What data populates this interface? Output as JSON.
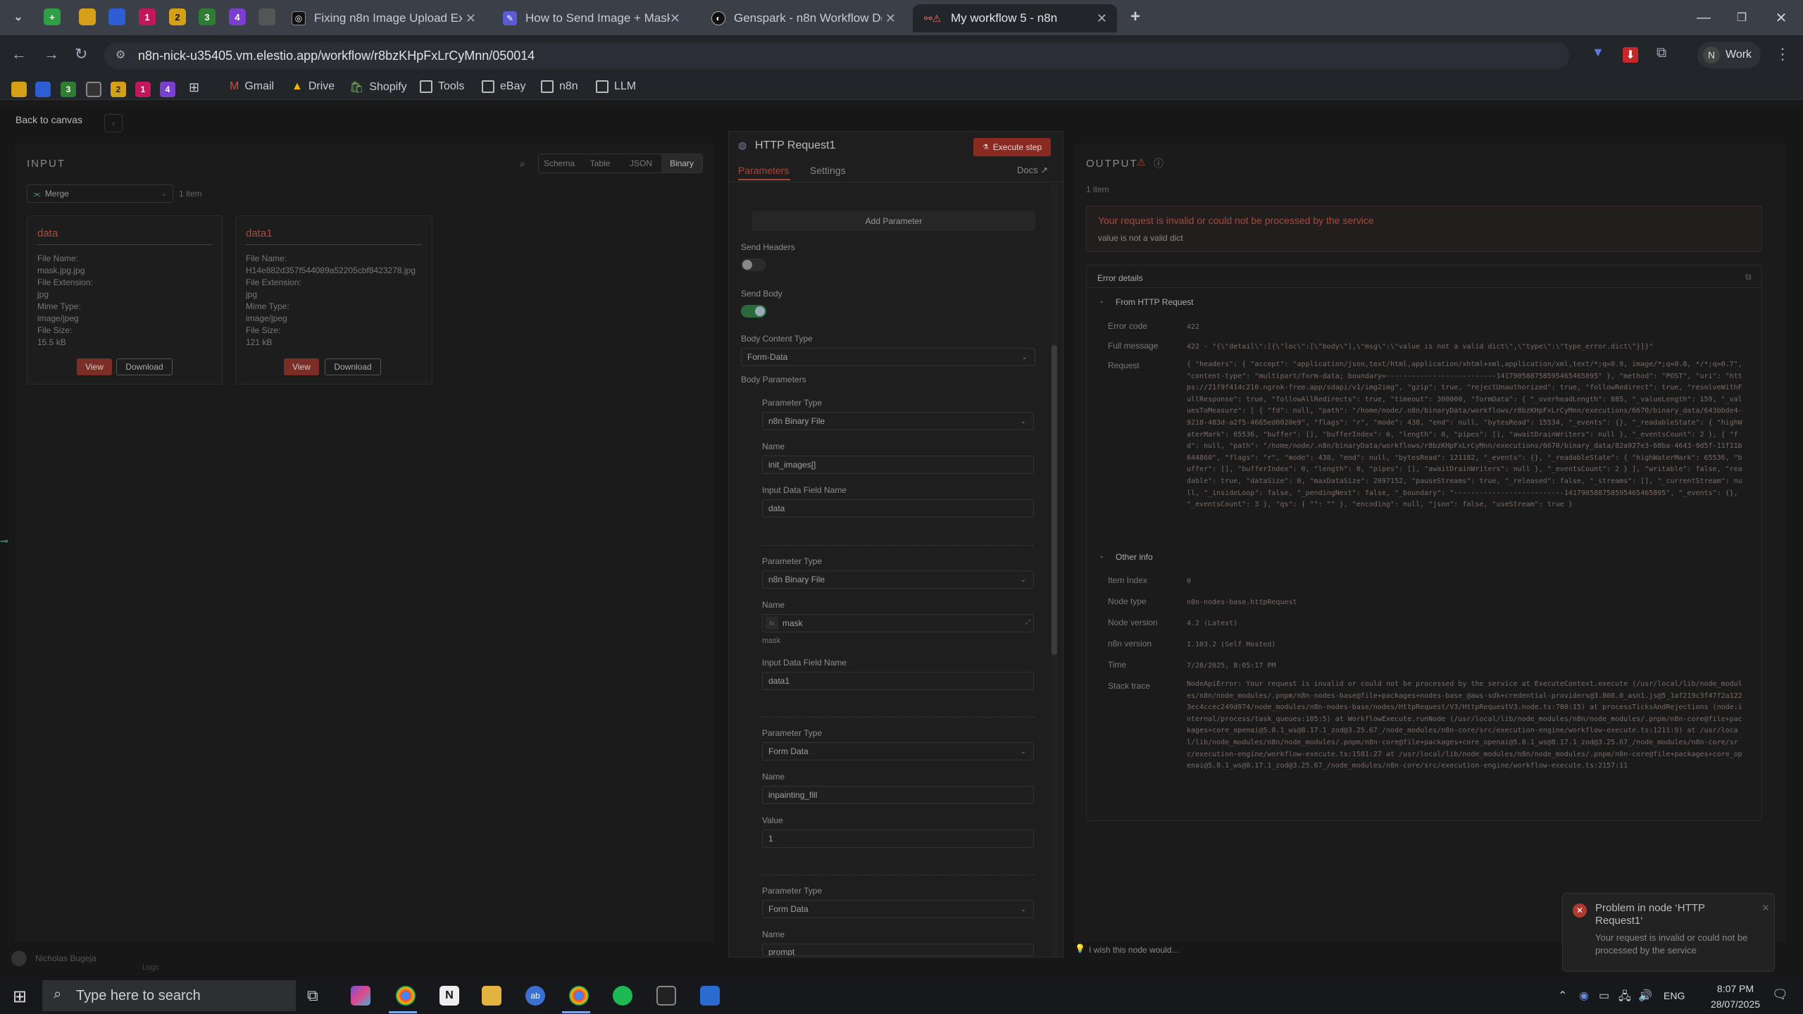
{
  "browser": {
    "tabs": [
      {
        "label": "Fixing n8n Image Upload Expre",
        "icon": "openai-icon"
      },
      {
        "label": "How to Send Image + Mask for",
        "icon": "claude-icon"
      },
      {
        "label": "Genspark - n8n Workflow Desi",
        "icon": "genspark-icon"
      },
      {
        "label": "My workflow 5 - n8n",
        "icon": "n8n-warning-icon"
      }
    ],
    "pinned_tabs": [
      "1",
      "2",
      "3",
      "4"
    ],
    "url": "n8n-nick-u35405.vm.elestio.app/workflow/r8bzKHpFxLrCyMnn/050014",
    "profile": {
      "initial": "N",
      "label": "Work"
    },
    "bookmark_pins": [
      "3",
      "2",
      "1",
      "4"
    ],
    "bookmarks": [
      "Gmail",
      "Drive",
      "Shopify",
      "Tools",
      "eBay",
      "n8n",
      "LLM"
    ]
  },
  "app": {
    "back_label": "Back to canvas",
    "input": {
      "title": "INPUT",
      "views": [
        "Schema",
        "Table",
        "JSON",
        "Binary"
      ],
      "active_view": "Binary",
      "source_node": "Merge",
      "item_count": "1 item",
      "cards": [
        {
          "title": "data",
          "lines": [
            "File Name:",
            "mask.jpg.jpg",
            "File Extension:",
            "jpg",
            "Mime Type:",
            "image/jpeg",
            "File Size:",
            "15.5 kB"
          ],
          "view": "View",
          "download": "Download"
        },
        {
          "title": "data1",
          "lines": [
            "File Name:",
            "H14e882d357f544089a52205cbf8423278.jpg",
            "File Extension:",
            "jpg",
            "Mime Type:",
            "image/jpeg",
            "File Size:",
            "121 kB"
          ],
          "view": "View",
          "download": "Download"
        }
      ]
    },
    "node": {
      "title": "HTTP Request1",
      "execute_label": "Execute step",
      "tabs": [
        "Parameters",
        "Settings"
      ],
      "docs_label": "Docs",
      "add_parameter": "Add Parameter",
      "send_headers_label": "Send Headers",
      "send_body_label": "Send Body",
      "body_content_type_label": "Body Content Type",
      "body_content_type": "Form-Data",
      "body_parameters_label": "Body Parameters",
      "params": [
        {
          "type_label": "Parameter Type",
          "type": "n8n Binary File",
          "name_label": "Name",
          "name": "init_images[]",
          "field_label": "Input Data Field Name",
          "field": "data"
        },
        {
          "type_label": "Parameter Type",
          "type": "n8n Binary File",
          "name_label": "Name",
          "name": "mask",
          "name_hint": "mask",
          "field_label": "Input Data Field Name",
          "field": "data1"
        },
        {
          "type_label": "Parameter Type",
          "type": "Form Data",
          "name_label": "Name",
          "name": "inpainting_fill",
          "field_label": "Value",
          "field": "1"
        },
        {
          "type_label": "Parameter Type",
          "type": "Form Data",
          "name_label": "Name",
          "name": "prompt"
        }
      ]
    },
    "output": {
      "title": "OUTPUT",
      "item_count": "1 item",
      "error_title": "Your request is invalid or could not be processed by the service",
      "error_sub": "value is not a valid dict",
      "details_title": "Error details",
      "from_label": "From HTTP Request",
      "rows": [
        {
          "label": "Error code",
          "value": "422"
        },
        {
          "label": "Full message",
          "value": "422 - \"{\\\"detail\\\":[{\\\"loc\\\":[\\\"body\\\"],\\\"msg\\\":\\\"value is not a valid dict\\\",\\\"type\\\":\\\"type_error.dict\\\"}]}\""
        },
        {
          "label": "Request",
          "value": "{ \"headers\": { \"accept\": \"application/json,text/html,application/xhtml+xml,application/xml,text/*;q=0.9, image/*;q=0.8, */*;q=0.7\", \"content-type\": \"multipart/form-data; boundary=--------------------------141790588758595465465895\" }, \"method\": \"POST\", \"uri\": \"https://21f9f414c210.ngrok-free.app/sdapi/v1/img2img\", \"gzip\": true, \"rejectUnauthorized\": true, \"followRedirect\": true, \"resolveWithFullResponse\": true, \"followAllRedirects\": true, \"timeout\": 300000, \"formData\": { \"_overheadLength\": 885, \"_valueLength\": 159, \"_valuesToMeasure\": [ { \"fd\": null, \"path\": \"/home/node/.n8n/binaryData/workflows/r8bzKHpFxLrCyMnn/executions/6670/binary_data/643bbde4-9218-483d-a2f5-4665ed0020e9\", \"flags\": \"r\", \"mode\": 438, \"end\": null, \"bytesRead\": 15534, \"_events\": {}, \"_readableState\": { \"highWaterMark\": 65536, \"buffer\": [], \"bufferIndex\": 0, \"length\": 0, \"pipes\": [], \"awaitDrainWriters\": null }, \"_eventsCount\": 2 }, { \"fd\": null, \"path\": \"/home/node/.n8n/binaryData/workflows/r8bzKHpFxLrCyMnn/executions/6670/binary_data/82a927e3-68ba-4643-9d5f-11f11b644860\", \"flags\": \"r\", \"mode\": 438, \"end\": null, \"bytesRead\": 121182, \"_events\": {}, \"_readableState\": { \"highWaterMark\": 65536, \"buffer\": [], \"bufferIndex\": 0, \"length\": 0, \"pipes\": [], \"awaitDrainWriters\": null }, \"_eventsCount\": 2 } ], \"writable\": false, \"readable\": true, \"dataSize\": 0, \"maxDataSize\": 2097152, \"pauseStreams\": true, \"_released\": false, \"_streams\": [], \"_currentStream\": null, \"_insideLoop\": false, \"_pendingNext\": false, \"_boundary\": \"--------------------------141790588758595465465895\", \"_events\": {}, \"_eventsCount\": 3 }, \"qs\": { \"\": \"\" }, \"encoding\": null, \"json\": false, \"useStream\": true }"
        }
      ],
      "other_label": "Other info",
      "other_rows": [
        {
          "label": "Item Index",
          "value": "0"
        },
        {
          "label": "Node type",
          "value": "n8n-nodes-base.httpRequest"
        },
        {
          "label": "Node version",
          "value": "4.2 (Latest)"
        },
        {
          "label": "n8n version",
          "value": "1.103.2 (Self Hosted)"
        },
        {
          "label": "Time",
          "value": "7/28/2025, 8:05:17 PM"
        },
        {
          "label": "Stack trace",
          "value": "NodeApiError: Your request is invalid or could not be processed by the service at ExecuteContext.execute (/usr/local/lib/node_modules/n8n/node_modules/.pnpm/n8n-nodes-base@file+packages+nodes-base_@aws-sdk+credential-providers@3.808.0_asn1.js@5_1af219c3f47f2a1223ec4ccec249d974/node_modules/n8n-nodes-base/nodes/HttpRequest/V3/HttpRequestV3.node.ts:780:15) at processTicksAndRejections (node:internal/process/task_queues:105:5) at WorkflowExecute.runNode (/usr/local/lib/node_modules/n8n/node_modules/.pnpm/n8n-core@file+packages+core_openai@5.8.1_ws@8.17.1_zod@3.25.67_/node_modules/n8n-core/src/execution-engine/workflow-execute.ts:1211:9) at /usr/local/lib/node_modules/n8n/node_modules/.pnpm/n8n-core@file+packages+core_openai@5.8.1_ws@8.17.1_zod@3.25.67_/node_modules/n8n-core/src/execution-engine/workflow-execute.ts:1581:27 at /usr/local/lib/node_modules/n8n/node_modules/.pnpm/n8n-core@file+packages+core_openai@5.8.1_ws@8.17.1_zod@3.25.67_/node_modules/n8n-core/src/execution-engine/workflow-execute.ts:2157:11"
        }
      ],
      "feedback": "I wish this node would..."
    },
    "toast": {
      "title": "Problem in node ‘HTTP Request1‘",
      "body": "Your request is invalid or could not be processed by the service"
    },
    "user_name": "Nicholas Bugeja",
    "logs_label": "Logs"
  },
  "taskbar": {
    "search_placeholder": "Type here to search",
    "lang": "ENG",
    "time": "8:07 PM",
    "date": "28/07/2025"
  }
}
